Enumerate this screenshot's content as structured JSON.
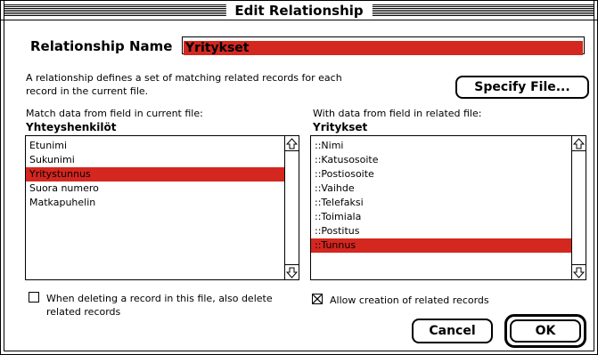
{
  "dialog": {
    "title": "Edit Relationship"
  },
  "relationship": {
    "name_label": "Relationship Name",
    "name_value": "Yritykset"
  },
  "description": "A relationship defines a set of matching related records for each record in the current file.",
  "specify_button": "Specify File...",
  "left_list": {
    "heading": "Match data from field in current file:",
    "file_name": "Yhteyshenkilöt",
    "items": [
      {
        "label": "Etunimi",
        "selected": false
      },
      {
        "label": "Sukunimi",
        "selected": false
      },
      {
        "label": "Yritystunnus",
        "selected": true
      },
      {
        "label": "Suora numero",
        "selected": false
      },
      {
        "label": "Matkapuhelin",
        "selected": false
      }
    ]
  },
  "right_list": {
    "heading": "With data from field in related file:",
    "file_name": "Yritykset",
    "items": [
      {
        "label": "::Nimi",
        "selected": false
      },
      {
        "label": "::Katusosoite",
        "selected": false
      },
      {
        "label": "::Postiosoite",
        "selected": false
      },
      {
        "label": "::Vaihde",
        "selected": false
      },
      {
        "label": "::Telefaksi",
        "selected": false
      },
      {
        "label": "::Toimiala",
        "selected": false
      },
      {
        "label": "::Postitus",
        "selected": false
      },
      {
        "label": "::Tunnus",
        "selected": true
      }
    ]
  },
  "options": {
    "delete_related": {
      "label": "When deleting a record in this file, also delete related records",
      "checked": false
    },
    "allow_creation": {
      "label": "Allow creation of related records",
      "checked": true
    }
  },
  "buttons": {
    "cancel": "Cancel",
    "ok": "OK"
  },
  "colors": {
    "selection": "#d4271f"
  }
}
